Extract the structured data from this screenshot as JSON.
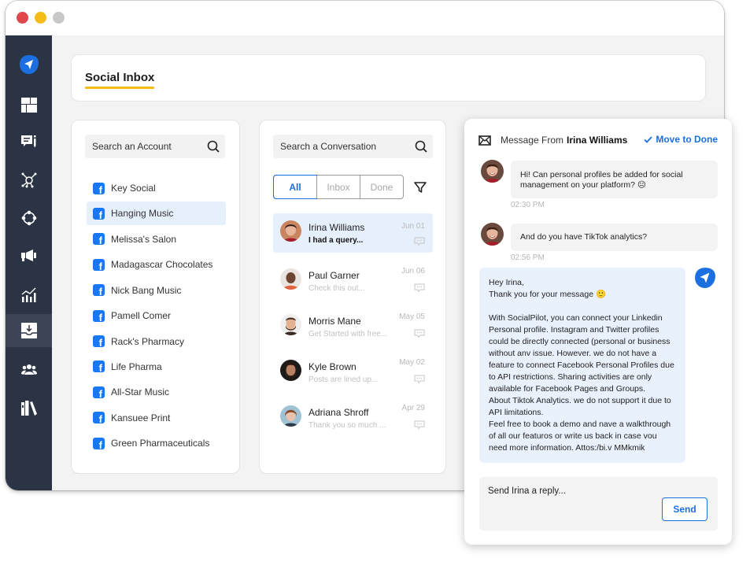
{
  "window": {
    "controls": [
      "close",
      "minimize",
      "maximize"
    ]
  },
  "sidebar": {
    "items": [
      {
        "name": "socialpilot-logo",
        "icon": "paper-plane-icon",
        "active": false
      },
      {
        "name": "dashboard",
        "icon": "dashboard-grid-icon",
        "active": false
      },
      {
        "name": "posts",
        "icon": "post-message-icon",
        "active": false
      },
      {
        "name": "connections",
        "icon": "network-hub-icon",
        "active": false
      },
      {
        "name": "integrations",
        "icon": "nodes-cycle-icon",
        "active": false
      },
      {
        "name": "campaigns",
        "icon": "megaphone-icon",
        "active": false
      },
      {
        "name": "analytics",
        "icon": "bar-chart-trend-icon",
        "active": false
      },
      {
        "name": "social-inbox",
        "icon": "inbox-download-icon",
        "active": true
      },
      {
        "name": "team",
        "icon": "users-group-icon",
        "active": false
      },
      {
        "name": "library",
        "icon": "books-library-icon",
        "active": false
      }
    ]
  },
  "header": {
    "title": "Social Inbox"
  },
  "colors": {
    "accent_blue": "#1c6fe0",
    "title_underline": "#f5bb16",
    "sidebar_bg": "#2b3444",
    "selected_bg": "#e6f0fc",
    "facebook": "#1877f2"
  },
  "accounts": {
    "search_placeholder": "Search an Account",
    "items": [
      {
        "label": "Key Social",
        "network": "facebook",
        "selected": false
      },
      {
        "label": "Hanging Music",
        "network": "facebook",
        "selected": true
      },
      {
        "label": "Melissa's Salon",
        "network": "facebook",
        "selected": false
      },
      {
        "label": "Madagascar Chocolates",
        "network": "facebook",
        "selected": false
      },
      {
        "label": "Nick Bang Music",
        "network": "facebook",
        "selected": false
      },
      {
        "label": "Pamell Comer",
        "network": "facebook",
        "selected": false
      },
      {
        "label": "Rack's Pharmacy",
        "network": "facebook",
        "selected": false
      },
      {
        "label": "Life Pharma",
        "network": "facebook",
        "selected": false
      },
      {
        "label": "All-Star Music",
        "network": "facebook",
        "selected": false
      },
      {
        "label": "Kansuee Print",
        "network": "facebook",
        "selected": false
      },
      {
        "label": "Green Pharmaceuticals",
        "network": "facebook",
        "selected": false
      }
    ]
  },
  "conversations": {
    "search_placeholder": "Search a Conversation",
    "tabs": [
      {
        "label": "All",
        "active": true
      },
      {
        "label": "Inbox",
        "active": false
      },
      {
        "label": "Done",
        "active": false
      }
    ],
    "items": [
      {
        "name": "Irina Williams",
        "snippet": "I had a query...",
        "date": "Jun 01",
        "selected": true
      },
      {
        "name": "Paul Garner",
        "snippet": "Check this out...",
        "date": "Jun 06",
        "selected": false
      },
      {
        "name": "Morris Mane",
        "snippet": "Get Started with free...",
        "date": "May 05",
        "selected": false
      },
      {
        "name": "Kyle Brown",
        "snippet": "Posts are lined up...",
        "date": "May 02",
        "selected": false
      },
      {
        "name": "Adriana Shroff",
        "snippet": "Thank you so much ...",
        "date": "Apr 29",
        "selected": false
      }
    ]
  },
  "message": {
    "from_label": "Message From",
    "from_name": "Irina Williams",
    "move_to_done": "Move to Done",
    "incoming": [
      {
        "text": "Hi! Can personal profiles be added for social management on your platform? 😐",
        "time": "02:30 PM"
      },
      {
        "text": "And do you have TikTok analytics?",
        "time": "02:56 PM"
      }
    ],
    "reply": {
      "text": "Hey Irina,\nThank you for your message 🙂\n\nWith SocialPilot, you can connect your Linkedin Personal profile. Instagram and Twitter profiles could be directly connected (personal or business without anv issue. However. we do not have a feature to connect Facebook Personal Profiles due to API restrictions. Sharing activities are only available for Facebook Pages and Groups.\nAbout Tiktok Analytics. we do not support it due to API limitations.\nFeel free to book a demo and nave a walkthrough of all our featuros or write us back in case vou need more information. Attos:/bi.v MMkmik"
    },
    "composer": {
      "placeholder": "Send Irina a reply...",
      "send_label": "Send"
    }
  }
}
